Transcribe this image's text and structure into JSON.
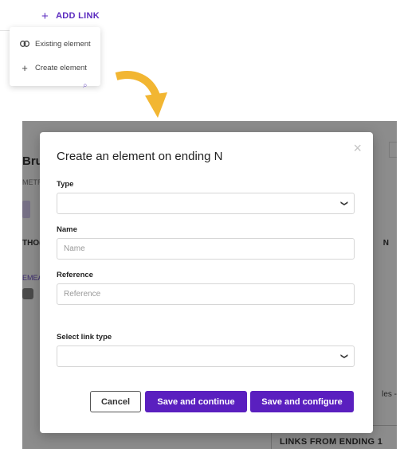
{
  "add_link": {
    "label": "ADD LINK"
  },
  "menu": {
    "items": [
      {
        "label": "Existing element",
        "icon": "link-icon"
      },
      {
        "label": "Create element",
        "icon": "plus-icon"
      }
    ]
  },
  "background": {
    "title_fragment": "Bru",
    "subtitle_fragment": "METR",
    "section_fragment": "THO(",
    "link_fragment": "EMEA",
    "right_fragment": "N",
    "side_text_fragment": "les -",
    "bottom_card": "LINKS FROM ENDING 1"
  },
  "modal": {
    "title": "Create an element on ending N",
    "close_label": "×",
    "type": {
      "label": "Type",
      "value": ""
    },
    "name": {
      "label": "Name",
      "placeholder": "Name"
    },
    "reference": {
      "label": "Reference",
      "placeholder": "Reference"
    },
    "link_type": {
      "label": "Select link type",
      "value": ""
    },
    "buttons": {
      "cancel": "Cancel",
      "save_continue": "Save and continue",
      "save_configure": "Save and configure"
    }
  },
  "colors": {
    "accent": "#5a1fbf",
    "arrow": "#f2b632"
  }
}
